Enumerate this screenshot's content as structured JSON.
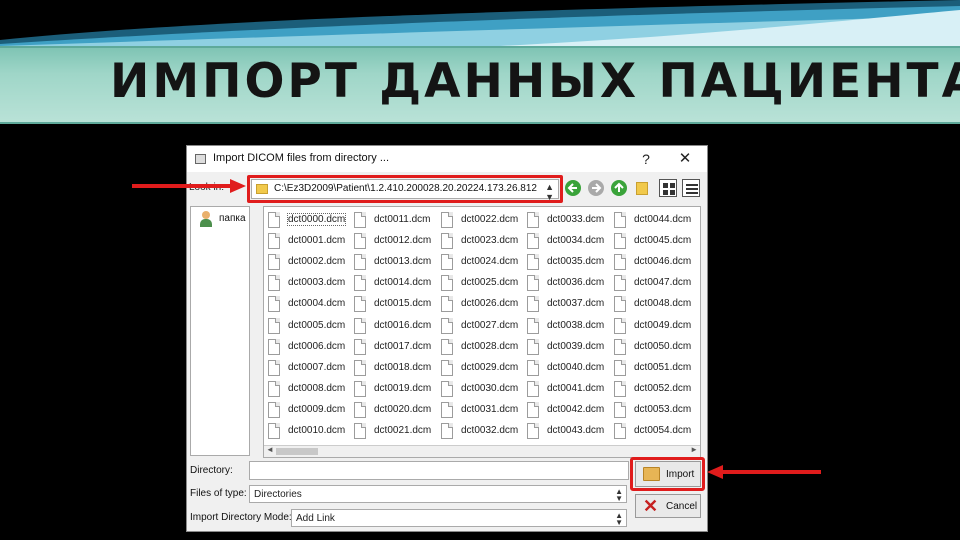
{
  "slide": {
    "title": "ИМПОРТ ДАННЫХ ПАЦИЕНТА"
  },
  "dialog": {
    "title": "Import DICOM files from directory ...",
    "help": "?",
    "close": "✕",
    "look_in_label": "Look in:",
    "path": "C:\\Ez3D2009\\Patient\\1.2.410.200028.20.20224.173.26.812",
    "sidebar": {
      "items": [
        {
          "label": "папка",
          "icon": "user-folder-icon"
        }
      ]
    },
    "files": [
      "dct0000.dcm",
      "dct0001.dcm",
      "dct0002.dcm",
      "dct0003.dcm",
      "dct0004.dcm",
      "dct0005.dcm",
      "dct0006.dcm",
      "dct0007.dcm",
      "dct0008.dcm",
      "dct0009.dcm",
      "dct0010.dcm",
      "dct0011.dcm",
      "dct0012.dcm",
      "dct0013.dcm",
      "dct0014.dcm",
      "dct0015.dcm",
      "dct0016.dcm",
      "dct0017.dcm",
      "dct0018.dcm",
      "dct0019.dcm",
      "dct0020.dcm",
      "dct0021.dcm",
      "dct0022.dcm",
      "dct0023.dcm",
      "dct0024.dcm",
      "dct0025.dcm",
      "dct0026.dcm",
      "dct0027.dcm",
      "dct0028.dcm",
      "dct0029.dcm",
      "dct0030.dcm",
      "dct0031.dcm",
      "dct0032.dcm",
      "dct0033.dcm",
      "dct0034.dcm",
      "dct0035.dcm",
      "dct0036.dcm",
      "dct0037.dcm",
      "dct0038.dcm",
      "dct0039.dcm",
      "dct0040.dcm",
      "dct0041.dcm",
      "dct0042.dcm",
      "dct0043.dcm",
      "dct0044.dcm",
      "dct0045.dcm",
      "dct0046.dcm",
      "dct0047.dcm",
      "dct0048.dcm",
      "dct0049.dcm",
      "dct0050.dcm",
      "dct0051.dcm",
      "dct0052.dcm",
      "dct0053.dcm",
      "dct0054.dcm"
    ],
    "directory_label": "Directory:",
    "directory_value": "",
    "file_type_label": "Files of type:",
    "file_type_value": "Directories",
    "import_mode_label": "Import Directory Mode:",
    "import_mode_value": "Add Link",
    "import_button": "Import",
    "cancel_button": "Cancel"
  },
  "colors": {
    "highlight": "#e01c1c",
    "title_band": "#9fd6c8",
    "nav_green": "#3aa33a"
  }
}
